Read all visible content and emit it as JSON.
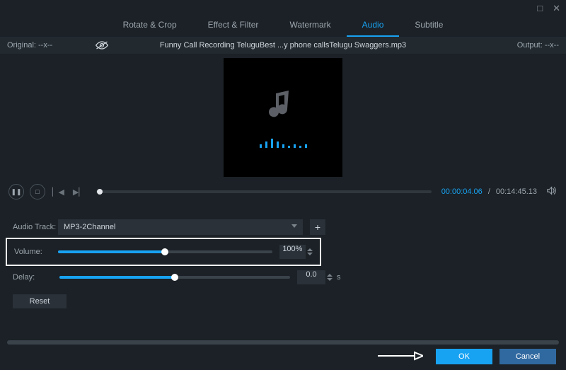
{
  "window": {
    "maximize": "□",
    "close": "✕"
  },
  "tabs": {
    "rotate": "Rotate & Crop",
    "effect": "Effect & Filter",
    "watermark": "Watermark",
    "audio": "Audio",
    "subtitle": "Subtitle"
  },
  "infobar": {
    "original_label": "Original: --x--",
    "filename": "Funny Call Recording TeluguBest ...y phone callsTelugu Swaggers.mp3",
    "output_label": "Output: --x--"
  },
  "playback": {
    "current": "00:00:04.06",
    "sep": "/",
    "total": "00:14:45.13",
    "progress_pct": 1
  },
  "settings": {
    "audio_track": {
      "label": "Audio Track:",
      "value": "MP3-2Channel"
    },
    "volume": {
      "label": "Volume:",
      "value": "100%",
      "pct": 50
    },
    "delay": {
      "label": "Delay:",
      "value": "0.0",
      "suffix": "s",
      "pct": 50
    },
    "reset": "Reset"
  },
  "buttons": {
    "ok": "OK",
    "cancel": "Cancel"
  },
  "icons": {
    "pause": "❚❚",
    "stop": "□",
    "prev": "▏◀",
    "next": "▶▏",
    "plus": "+"
  },
  "eq_heights": [
    5,
    9,
    13,
    9,
    5,
    3,
    5,
    3,
    5
  ]
}
